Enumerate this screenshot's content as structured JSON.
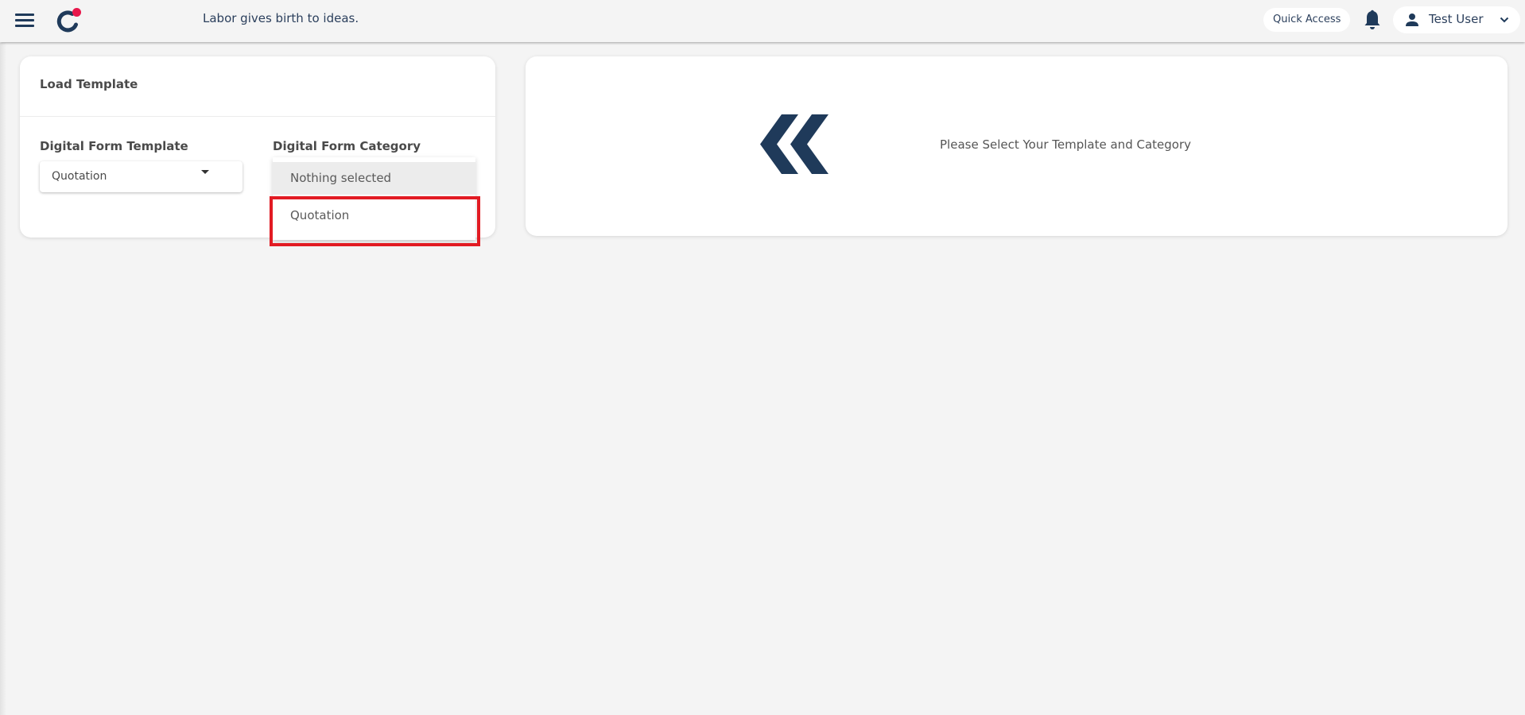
{
  "header": {
    "menu_icon": "hamburger-menu-icon",
    "logo_icon": "app-logo-icon",
    "tagline": "Labor gives birth to ideas.",
    "quick_access_label": "Quick Access",
    "notification_icon": "bell-icon",
    "user": {
      "icon": "person-icon",
      "name": "Test User",
      "dropdown_icon": "chevron-down-icon"
    }
  },
  "load_template_card": {
    "title": "Load Template",
    "template_field": {
      "label": "Digital Form Template",
      "value": "Quotation",
      "icon": "caret-down-icon"
    },
    "category_field": {
      "label": "Digital Form Category",
      "open": true,
      "options": [
        {
          "label": "Nothing selected",
          "hovered": true
        },
        {
          "label": "Quotation",
          "highlighted": true
        }
      ]
    }
  },
  "preview_card": {
    "icon": "double-chevron-left-icon",
    "message": "Please Select Your Template and Category"
  },
  "colors": {
    "primary": "#1f3a5a",
    "accent": "#e8174b",
    "highlight_box": "#e21b23",
    "background": "#f4f4f4"
  }
}
